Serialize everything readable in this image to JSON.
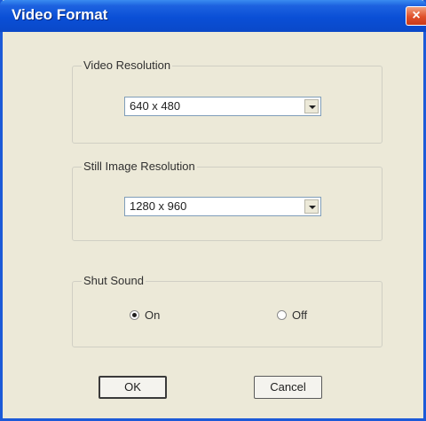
{
  "window": {
    "title": "Video Format",
    "close_glyph": "×"
  },
  "video_resolution": {
    "label": "Video Resolution",
    "value": "640 x 480"
  },
  "still_image_resolution": {
    "label": "Still Image Resolution",
    "value": "1280 x 960"
  },
  "shut_sound": {
    "label": "Shut Sound",
    "options": [
      {
        "label": "On",
        "checked": true
      },
      {
        "label": "Off",
        "checked": false
      }
    ]
  },
  "buttons": {
    "ok": "OK",
    "cancel": "Cancel"
  },
  "colors": {
    "titlebar": "#0a4fd6",
    "window_bg": "#ece9d8",
    "close_button": "#e0502a"
  }
}
